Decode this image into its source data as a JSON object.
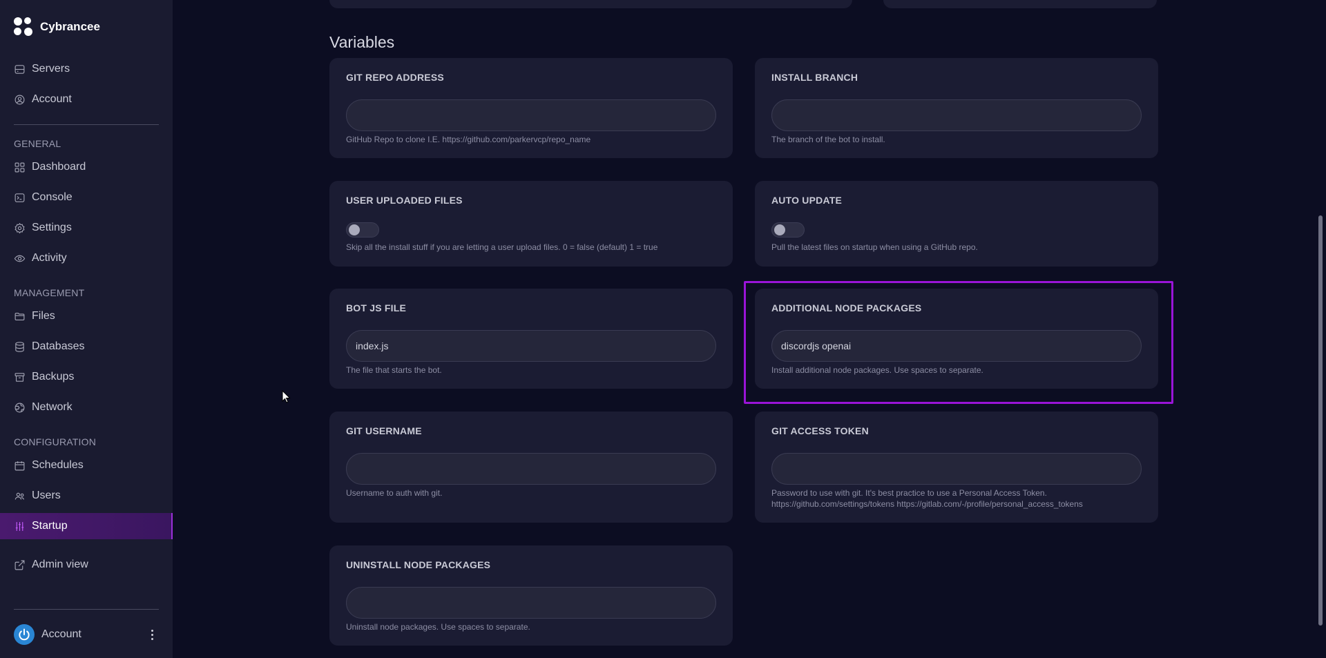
{
  "brand": {
    "name": "Cybrancee"
  },
  "sidebar": {
    "top_items": [
      {
        "label": "Servers",
        "icon": "server-icon"
      },
      {
        "label": "Account",
        "icon": "user-circle-icon"
      }
    ],
    "sections": [
      {
        "label": "GENERAL",
        "items": [
          {
            "label": "Dashboard",
            "icon": "grid-icon"
          },
          {
            "label": "Console",
            "icon": "terminal-icon"
          },
          {
            "label": "Settings",
            "icon": "gear-icon"
          },
          {
            "label": "Activity",
            "icon": "eye-icon"
          }
        ]
      },
      {
        "label": "MANAGEMENT",
        "items": [
          {
            "label": "Files",
            "icon": "folder-icon"
          },
          {
            "label": "Databases",
            "icon": "database-icon"
          },
          {
            "label": "Backups",
            "icon": "archive-icon"
          },
          {
            "label": "Network",
            "icon": "globe-icon"
          }
        ]
      },
      {
        "label": "CONFIGURATION",
        "items": [
          {
            "label": "Schedules",
            "icon": "calendar-icon"
          },
          {
            "label": "Users",
            "icon": "users-icon"
          },
          {
            "label": "Startup",
            "icon": "sliders-icon",
            "active": true
          }
        ]
      }
    ],
    "admin_view": {
      "label": "Admin view",
      "icon": "external-link-icon"
    },
    "account": {
      "label": "Account",
      "icon": "power-icon"
    }
  },
  "main": {
    "title": "Variables",
    "variables": [
      {
        "title": "GIT REPO ADDRESS",
        "type": "text",
        "value": "",
        "hint": "GitHub Repo to clone I.E. https://github.com/parkervcp/repo_name"
      },
      {
        "title": "INSTALL BRANCH",
        "type": "text",
        "value": "",
        "hint": "The branch of the bot to install."
      },
      {
        "title": "USER UPLOADED FILES",
        "type": "toggle",
        "value": "off",
        "hint": "Skip all the install stuff if you are letting a user upload files. 0 = false (default) 1 = true"
      },
      {
        "title": "AUTO UPDATE",
        "type": "toggle",
        "value": "off",
        "hint": "Pull the latest files on startup when using a GitHub repo."
      },
      {
        "title": "BOT JS FILE",
        "type": "text",
        "value": "index.js",
        "hint": "The file that starts the bot."
      },
      {
        "title": "ADDITIONAL NODE PACKAGES",
        "type": "text",
        "value": "discordjs openai",
        "hint": "Install additional node packages. Use spaces to separate."
      },
      {
        "title": "GIT USERNAME",
        "type": "text",
        "value": "",
        "hint": "Username to auth with git."
      },
      {
        "title": "GIT ACCESS TOKEN",
        "type": "text",
        "value": "",
        "hint": "Password to use with git. It's best practice to use a Personal Access Token.",
        "hint2": "https://github.com/settings/tokens https://gitlab.com/-/profile/personal_access_tokens"
      },
      {
        "title": "UNINSTALL NODE PACKAGES",
        "type": "text",
        "value": "",
        "hint": "Uninstall node packages. Use spaces to separate."
      }
    ]
  },
  "colors": {
    "accent": "#9a14d8",
    "background": "#0c0d22",
    "sidebar": "#1a1b30",
    "card": "#1b1c33"
  }
}
